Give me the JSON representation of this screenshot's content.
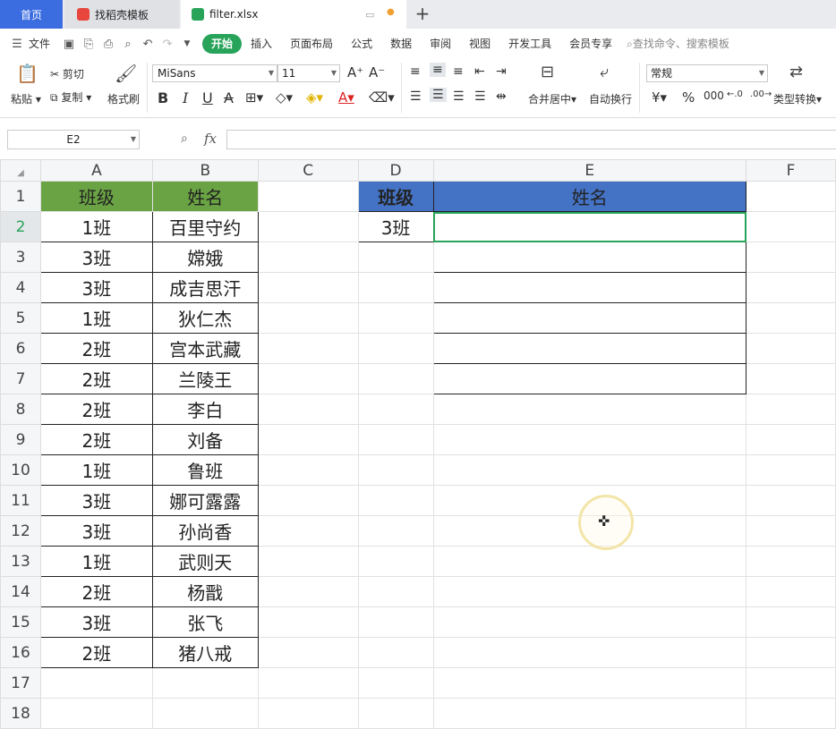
{
  "tabs": {
    "home": "首页",
    "template": "找稻壳模板",
    "file": "filter.xlsx",
    "add": "+"
  },
  "menu": {
    "file": "文件",
    "items": [
      "开始",
      "插入",
      "页面布局",
      "公式",
      "数据",
      "审阅",
      "视图",
      "开发工具",
      "会员专享"
    ],
    "search": "查找命令、搜索模板"
  },
  "ribbon": {
    "paste": "粘贴",
    "cut": "剪切",
    "copy": "复制",
    "format_painter": "格式刷",
    "font_name": "MiSans",
    "font_size": "11",
    "merge": "合并居中",
    "wrap": "自动换行",
    "number_format": "常规",
    "convert": "类型转换"
  },
  "formula_bar": {
    "name_box": "E2",
    "fx": "fx",
    "formula": ""
  },
  "columns": [
    "A",
    "B",
    "C",
    "D",
    "E",
    "F"
  ],
  "rows": [
    {
      "n": "1",
      "a": "班级",
      "b": "姓名",
      "d": "班级",
      "e": "姓名"
    },
    {
      "n": "2",
      "a": "1班",
      "b": "百里守约",
      "d": "3班",
      "e": ""
    },
    {
      "n": "3",
      "a": "3班",
      "b": "嫦娥"
    },
    {
      "n": "4",
      "a": "3班",
      "b": "成吉思汗"
    },
    {
      "n": "5",
      "a": "1班",
      "b": "狄仁杰"
    },
    {
      "n": "6",
      "a": "2班",
      "b": "宫本武藏"
    },
    {
      "n": "7",
      "a": "2班",
      "b": "兰陵王"
    },
    {
      "n": "8",
      "a": "2班",
      "b": "李白"
    },
    {
      "n": "9",
      "a": "2班",
      "b": "刘备"
    },
    {
      "n": "10",
      "a": "1班",
      "b": "鲁班"
    },
    {
      "n": "11",
      "a": "3班",
      "b": "娜可露露"
    },
    {
      "n": "12",
      "a": "3班",
      "b": "孙尚香"
    },
    {
      "n": "13",
      "a": "1班",
      "b": "武则天"
    },
    {
      "n": "14",
      "a": "2班",
      "b": "杨戬"
    },
    {
      "n": "15",
      "a": "3班",
      "b": "张飞"
    },
    {
      "n": "16",
      "a": "2班",
      "b": "猪八戒"
    },
    {
      "n": "17"
    },
    {
      "n": "18"
    }
  ],
  "colors": {
    "header_green": "#6aa343",
    "header_blue": "#4472c4",
    "accent": "#27a35a",
    "home_tab": "#3b6de0"
  },
  "selected_cell": "E2"
}
